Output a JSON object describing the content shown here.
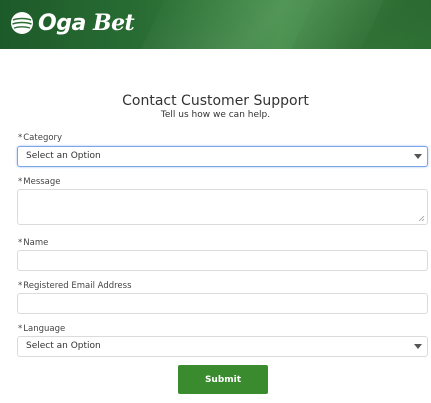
{
  "header": {
    "logo_primary": "Oga",
    "logo_secondary": "Bet",
    "logo_icon": "ball-icon",
    "colors": {
      "dark_green": "#1d5a2a",
      "mid_green": "#3f8a44"
    }
  },
  "form": {
    "title": "Contact Customer Support",
    "subtitle": "Tell us how we can help.",
    "required_mark": "*",
    "category": {
      "label": "Category",
      "value": "Select an Option"
    },
    "message": {
      "label": "Message",
      "value": ""
    },
    "name": {
      "label": "Name",
      "value": ""
    },
    "email": {
      "label": "Registered Email Address",
      "value": ""
    },
    "language": {
      "label": "Language",
      "value": "Select an Option"
    },
    "submit_label": "Submit",
    "colors": {
      "submit_bg": "#3a8a2e",
      "focus_border": "#7aa6e8",
      "field_border": "#dddbda"
    }
  }
}
